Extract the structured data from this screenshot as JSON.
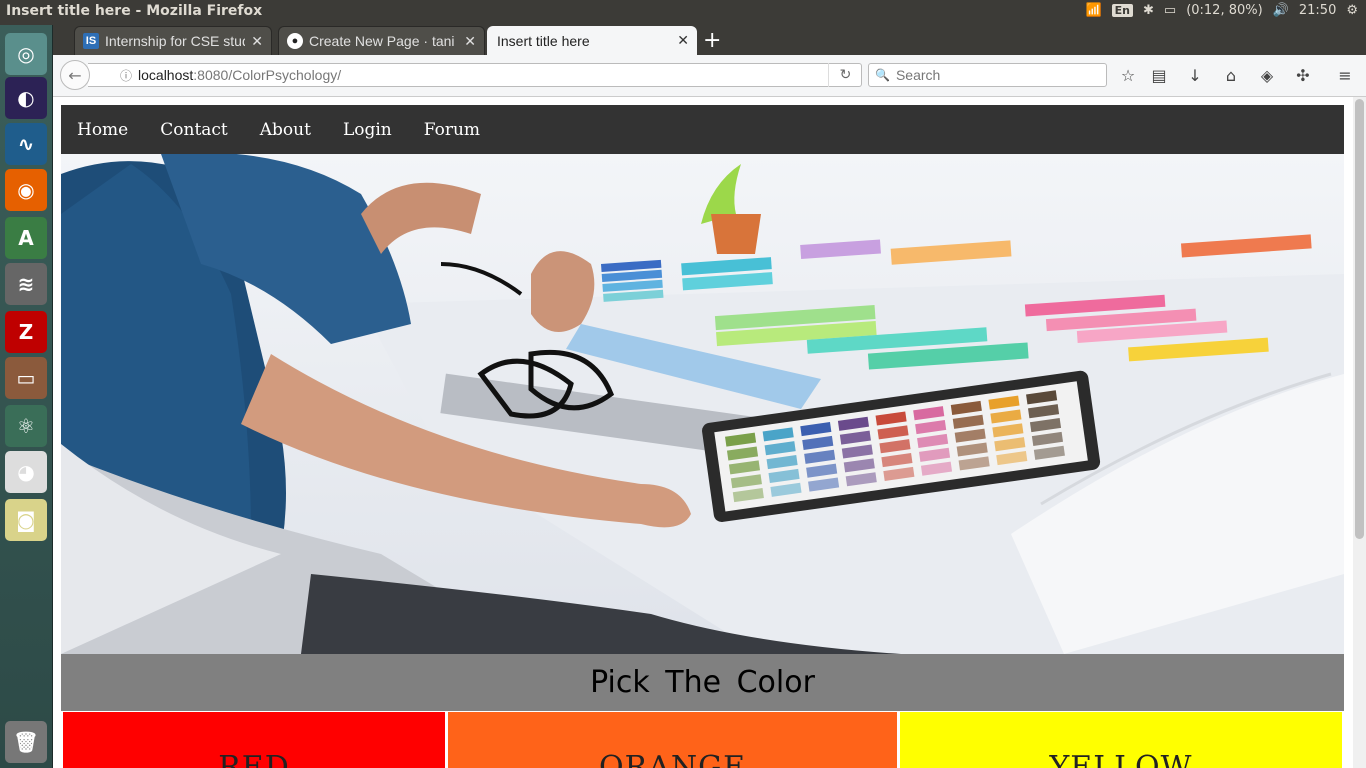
{
  "os": {
    "window_title": "Insert title here - Mozilla Firefox",
    "lang": "En",
    "battery": "(0:12, 80%)",
    "time": "21:50"
  },
  "launcher": [
    {
      "name": "ubuntu-dash-icon",
      "color": "#5a8f8c"
    },
    {
      "name": "eclipse-icon",
      "color": "#2c2255"
    },
    {
      "name": "wireshark-icon",
      "color": "#1f5d8c"
    },
    {
      "name": "firefox-icon",
      "color": "#e66000"
    },
    {
      "name": "android-studio-icon",
      "color": "#3a7d44"
    },
    {
      "name": "database-icon",
      "color": "#666"
    },
    {
      "name": "filezilla-icon",
      "color": "#bf0000"
    },
    {
      "name": "file-manager-icon",
      "color": "#8b5a3c"
    },
    {
      "name": "atom-icon",
      "color": "#3a6e58"
    },
    {
      "name": "chrome-icon",
      "color": "#ddd"
    },
    {
      "name": "speaker-icon",
      "color": "#d9d38a"
    },
    {
      "name": "trash-icon",
      "color": "#777"
    }
  ],
  "tabs": [
    {
      "label": "Internship for CSE stud",
      "icon": "IS"
    },
    {
      "label": "Create New Page · tani",
      "icon": "⌥"
    },
    {
      "label": "Insert title here",
      "icon": ""
    }
  ],
  "url": {
    "host": "localhost",
    "path": ":8080/ColorPsychology/"
  },
  "search": {
    "placeholder": "Search"
  },
  "site": {
    "nav": [
      "Home",
      "Contact",
      "About",
      "Login",
      "Forum"
    ],
    "pick_title": "Pick The Color"
  },
  "colors": [
    {
      "label": "RED",
      "color": "#ff0000"
    },
    {
      "label": "ORANGE",
      "color": "#ff6319"
    },
    {
      "label": "YELLOW",
      "color": "#ffff00"
    }
  ]
}
